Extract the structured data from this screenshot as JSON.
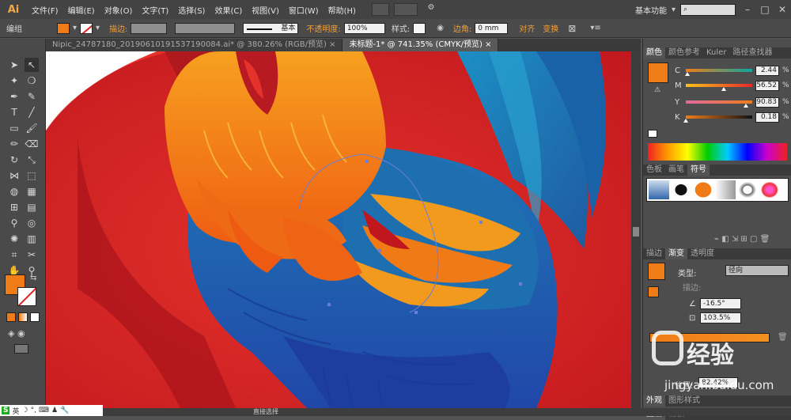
{
  "app": {
    "logo": "Ai",
    "workspace": "基本功能",
    "search_placeholder": ""
  },
  "menu": [
    "文件(F)",
    "编辑(E)",
    "对象(O)",
    "文字(T)",
    "选择(S)",
    "效果(C)",
    "视图(V)",
    "窗口(W)",
    "帮助(H)"
  ],
  "control_bar": {
    "selection_label": "编组",
    "stroke_label": "描边:",
    "stroke_style": "基本",
    "opacity_label": "不透明度:",
    "opacity_value": "100%",
    "style_label": "样式:",
    "corner_label": "边角:",
    "corner_value": "0 mm",
    "align_label": "对齐",
    "transform_label": "变换",
    "fill_color": "#f07c17"
  },
  "tabs": [
    {
      "label": "Nipic_24787180_20190610191537190084.ai* @ 380.26% (RGB/预览)",
      "close": "×",
      "active": false
    },
    {
      "label": "未标题-1* @ 741.35% (CMYK/预览)",
      "close": "×",
      "active": true
    }
  ],
  "color_panel": {
    "tabs": [
      "颜色",
      "颜色参考",
      "Kuler",
      "路径查找器"
    ],
    "fill_color": "#f07c17",
    "channels": [
      {
        "name": "C",
        "value": "2.44",
        "fill": 0.02
      },
      {
        "name": "M",
        "value": "56.52",
        "fill": 0.57
      },
      {
        "name": "Y",
        "value": "90.83",
        "fill": 0.91
      },
      {
        "name": "K",
        "value": "0.18",
        "fill": 0.0
      }
    ],
    "pct": "%"
  },
  "symbols_panel": {
    "tabs": [
      "色板",
      "画笔",
      "符号"
    ]
  },
  "gradient_panel": {
    "tabs": [
      "描边",
      "渐变",
      "透明度"
    ],
    "type_label": "类型:",
    "type_value": "径向",
    "stroke_label": "描边:",
    "angle_value": "-16.5°",
    "ratio_value": "103.5%",
    "location_label": "位置:",
    "location_value": "82.42%"
  },
  "bottom_tabs": [
    "外观",
    "图形样式"
  ],
  "layers_tabs": [
    "图层",
    "画板"
  ],
  "status": {
    "zoom_text": "直接选择"
  },
  "ime": {
    "lang": "英"
  },
  "watermark": {
    "text": "经验",
    "url": "jingyan.baidu.com"
  }
}
